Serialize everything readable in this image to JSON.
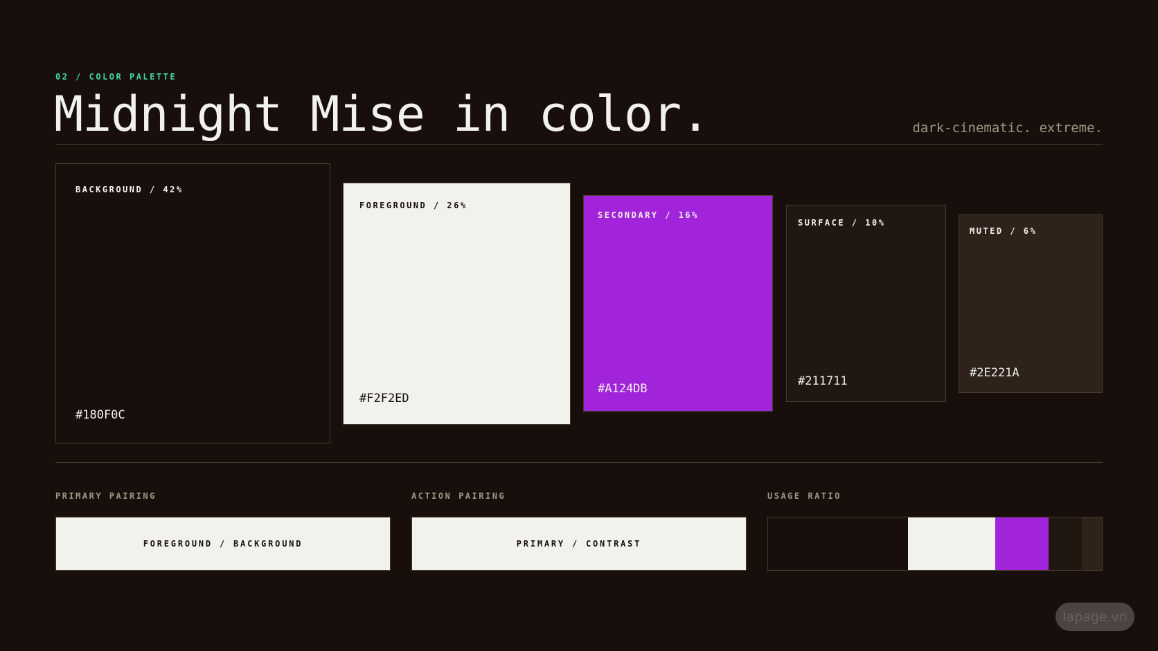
{
  "header": {
    "eyebrow": "02 / COLOR PALETTE",
    "title": "Midnight Mise in color.",
    "tagline": "dark-cinematic. extreme."
  },
  "swatches": [
    {
      "label": "BACKGROUND / 42%",
      "hex": "#180F0C",
      "color": "#180F0C",
      "text_color": "#F2F2ED"
    },
    {
      "label": "FOREGROUND / 26%",
      "hex": "#F2F2ED",
      "color": "#F2F2ED",
      "text_color": "#180F0C"
    },
    {
      "label": "SECONDARY / 16%",
      "hex": "#A124DB",
      "color": "#A124DB",
      "text_color": "#F2F2ED"
    },
    {
      "label": "SURFACE / 10%",
      "hex": "#211711",
      "color": "#211711",
      "text_color": "#F2F2ED"
    },
    {
      "label": "MUTED / 6%",
      "hex": "#2E221A",
      "color": "#2E221A",
      "text_color": "#F2F2ED"
    }
  ],
  "pairings": {
    "primary": {
      "section_label": "PRIMARY PAIRING",
      "text": "FOREGROUND / BACKGROUND"
    },
    "action": {
      "section_label": "ACTION PAIRING",
      "text": "PRIMARY / CONTRAST"
    },
    "usage": {
      "section_label": "USAGE RATIO"
    }
  },
  "usage_ratio": [
    {
      "color": "#180F0C",
      "percent": 42
    },
    {
      "color": "#F2F2ED",
      "percent": 26
    },
    {
      "color": "#A124DB",
      "percent": 16
    },
    {
      "color": "#211711",
      "percent": 10
    },
    {
      "color": "#2E221A",
      "percent": 6
    }
  ],
  "colors": {
    "accent": "#3FD8A6",
    "border": "#4A3A30",
    "muted_text": "#A29585"
  },
  "watermark": "lapage.vn"
}
